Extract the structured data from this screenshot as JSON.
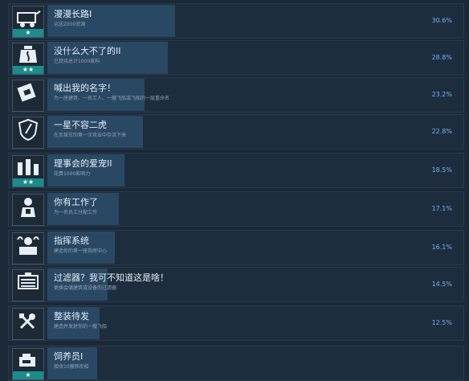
{
  "achievements": [
    {
      "title": "漫漫长路I",
      "desc": "运送2000资源",
      "percent": "30.6%",
      "progress": 0.306,
      "stars": 1,
      "icon": "cart-icon"
    },
    {
      "title": "没什么大不了的II",
      "desc": "已焚烧总计1000废料",
      "percent": "28.8%",
      "progress": 0.288,
      "stars": 2,
      "icon": "incinerator-icon"
    },
    {
      "title": "喊出我的名字！",
      "desc": "为一座建筑、一名工人、一艘飞船或飞船的一层重命名",
      "percent": "23.2%",
      "progress": 0.232,
      "stars": 0,
      "icon": "name-tag-icon"
    },
    {
      "title": "一星不容二虎",
      "desc": "在反叛军的第一次攻击中存活下来",
      "percent": "22.8%",
      "progress": 0.228,
      "stars": 0,
      "icon": "shield-icon"
    },
    {
      "title": "理事会的爱宠II",
      "desc": "花费1000影响力",
      "percent": "18.5%",
      "progress": 0.185,
      "stars": 2,
      "icon": "council-icon"
    },
    {
      "title": "你有工作了",
      "desc": "为一名员工分配工作",
      "percent": "17.1%",
      "progress": 0.171,
      "stars": 0,
      "icon": "worker-icon"
    },
    {
      "title": "指挥系统",
      "desc": "建造你的第一座指挥中心",
      "percent": "16.1%",
      "progress": 0.161,
      "stars": 0,
      "icon": "command-icon"
    },
    {
      "title": "过滤器？我可不知道这是啥！",
      "desc": "更换会储建筑或设备的过滤器",
      "percent": "14.5%",
      "progress": 0.145,
      "stars": 0,
      "icon": "filter-machine-icon"
    },
    {
      "title": "整装待发",
      "desc": "建造并发射你的一艘飞船",
      "percent": "12.5%",
      "progress": 0.125,
      "stars": 0,
      "icon": "tools-icon"
    },
    {
      "title": "饲养员I",
      "desc": "接收10艘移民船",
      "percent": "",
      "progress": 0.12,
      "stars": 1,
      "icon": "keeper-icon"
    }
  ],
  "star_glyph": "★"
}
